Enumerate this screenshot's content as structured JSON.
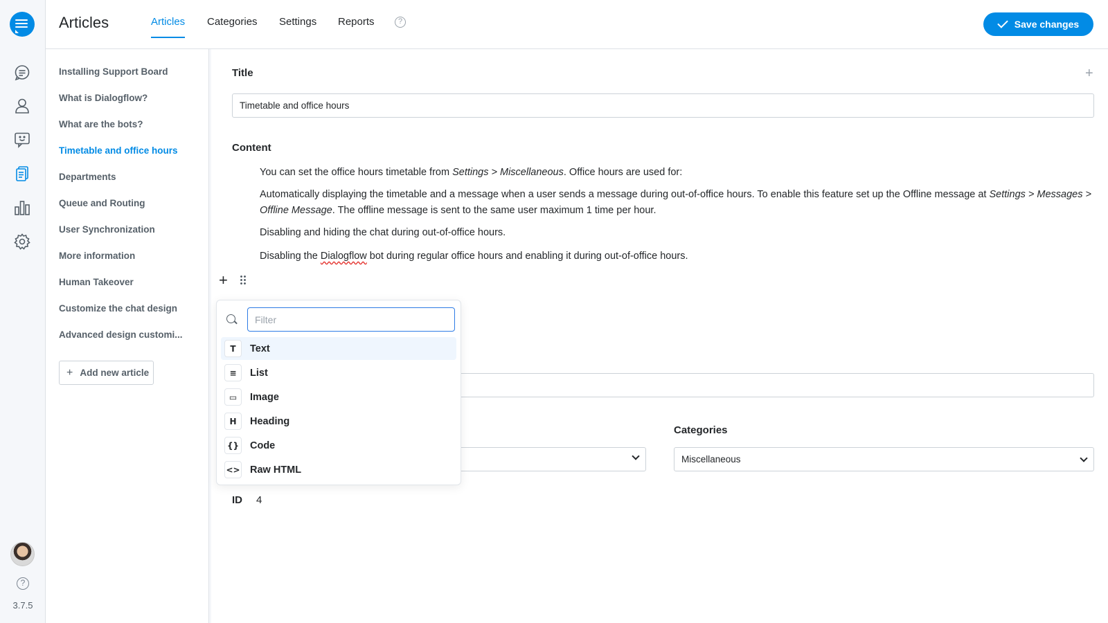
{
  "app": {
    "version": "3.7.5"
  },
  "header": {
    "title": "Articles",
    "tabs": [
      {
        "label": "Articles",
        "active": true
      },
      {
        "label": "Categories",
        "active": false
      },
      {
        "label": "Settings",
        "active": false
      },
      {
        "label": "Reports",
        "active": false
      }
    ],
    "help_glyph": "?",
    "save_label": "Save changes"
  },
  "sidebar": {
    "icons": [
      "conversations-icon",
      "users-icon",
      "chatbot-icon",
      "articles-icon",
      "reports-icon",
      "settings-icon"
    ],
    "active_icon": "articles-icon"
  },
  "articles": {
    "items": [
      {
        "label": "Installing Support Board"
      },
      {
        "label": "What is Dialogflow?"
      },
      {
        "label": "What are the bots?"
      },
      {
        "label": "Timetable and office hours",
        "active": true
      },
      {
        "label": "Departments"
      },
      {
        "label": "Queue and Routing"
      },
      {
        "label": "User Synchronization"
      },
      {
        "label": "More information"
      },
      {
        "label": "Human Takeover"
      },
      {
        "label": "Customize the chat design"
      },
      {
        "label": "Advanced design customi..."
      }
    ],
    "add_label": "Add new article"
  },
  "editor": {
    "title_label": "Title",
    "title_value": "Timetable and office hours",
    "content_label": "Content",
    "paragraphs": [
      {
        "pre": "You can set the office hours timetable from ",
        "italic": "Settings > Miscellaneous",
        "post": ". Office hours are used for:"
      },
      {
        "pre": "Automatically displaying the timetable and a message when a user sends a message during out-of-office hours. To enable this feature set up the Offline message at ",
        "italic": "Settings > Messages > Offline Message",
        "post": ". The offline message is sent to the same user maximum 1 time per hour."
      },
      {
        "text": "Disabling and hiding the chat during out-of-office hours."
      },
      {
        "pre": "Disabling the ",
        "misspelled": "Dialogflow",
        "post": " bot during regular office hours and enabling it during out-of-office hours."
      }
    ],
    "categories_label": "Categories",
    "categories_value": "Miscellaneous",
    "id_label": "ID",
    "id_value": "4"
  },
  "block_menu": {
    "filter_placeholder": "Filter",
    "tools": [
      {
        "label": "Text",
        "glyph": "T",
        "icon": "text-icon",
        "active": true
      },
      {
        "label": "List",
        "glyph": "≡",
        "icon": "list-icon"
      },
      {
        "label": "Image",
        "glyph": "▭",
        "icon": "image-icon"
      },
      {
        "label": "Heading",
        "glyph": "H",
        "icon": "heading-icon"
      },
      {
        "label": "Code",
        "glyph": "{}",
        "icon": "code-icon"
      },
      {
        "label": "Raw HTML",
        "glyph": "<>",
        "icon": "raw-html-icon"
      }
    ]
  },
  "colors": {
    "accent": "#028be5",
    "text": "#24272a",
    "muted": "#566069"
  }
}
